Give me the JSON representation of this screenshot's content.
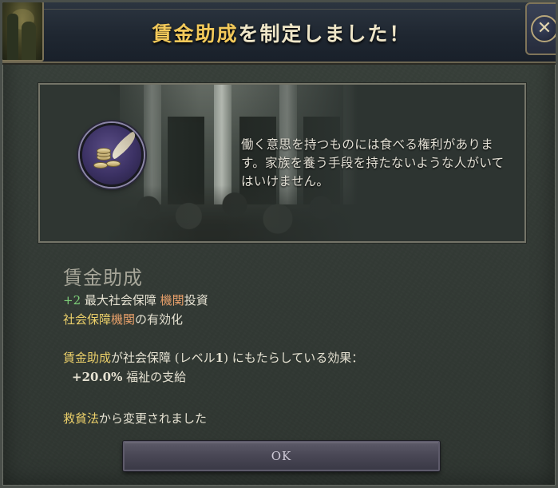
{
  "dialog": {
    "title_highlight": "賃金助成",
    "title_rest": "を制定しました！",
    "close_glyph": "✕"
  },
  "event": {
    "quote": "働く意思を持つものには食べる権利があります。家族を養う手段を持たないような人がいてはいけません。",
    "icon": "coins-feather-icon"
  },
  "law": {
    "name": "賃金助成",
    "effect_line1": {
      "value": "+2",
      "text": " 最大社会保障 ",
      "highlight": "機関",
      "suffix": "投資"
    },
    "effect_line2": {
      "prefix": "社会保障",
      "highlight": "機関",
      "suffix": "の有効化"
    },
    "effects_header": {
      "law": "賃金助成",
      "mid": "が社会保障 (レベル",
      "level": "1",
      "end": ") にもたらしている効果："
    },
    "effect_detail": {
      "value": "+20.0%",
      "text": " 福祉の支給"
    },
    "changed_from": {
      "law": "救貧法",
      "text": "から変更されました"
    }
  },
  "buttons": {
    "ok": "OK"
  },
  "colors": {
    "title_gold": "#f3c95a",
    "positive_green": "#7fd27a",
    "law_gold": "#ecd06a",
    "institution_salmon": "#e8a06a"
  }
}
